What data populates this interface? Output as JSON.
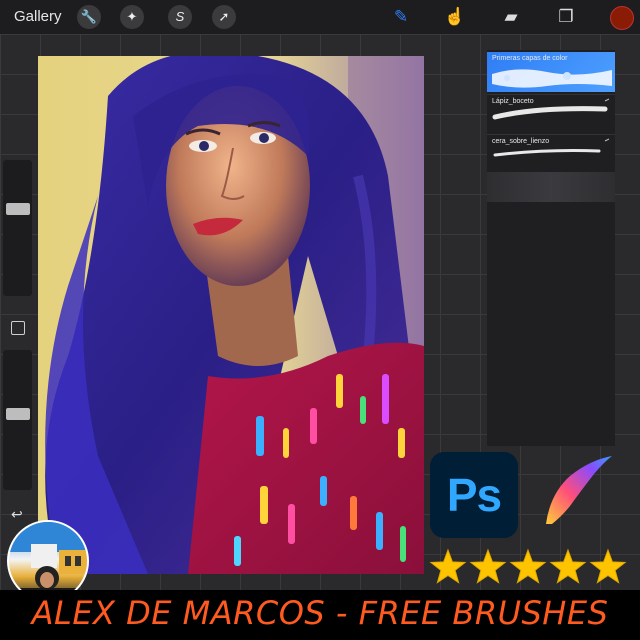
{
  "topbar": {
    "gallery_label": "Gallery",
    "actions": [
      {
        "name": "wrench-icon",
        "glyph": "🔧"
      },
      {
        "name": "magic-wand-icon",
        "glyph": "✦"
      },
      {
        "name": "selection-icon",
        "glyph": "S"
      },
      {
        "name": "transform-arrow-icon",
        "glyph": "➚"
      }
    ],
    "tools": [
      {
        "name": "brush-icon",
        "glyph": "✎"
      },
      {
        "name": "smudge-icon",
        "glyph": "☝"
      },
      {
        "name": "eraser-icon",
        "glyph": "▰"
      },
      {
        "name": "layers-icon",
        "glyph": "❐"
      }
    ],
    "current_color": "#8a1c06",
    "accent_color": "#2f7df5"
  },
  "brush_library": {
    "brushes": [
      {
        "name": "Primeras capas de color",
        "selected": true
      },
      {
        "name": "Lápiz_boceto",
        "selected": false
      },
      {
        "name": "cera_sobre_lienzo",
        "selected": false
      }
    ]
  },
  "sidebar": {
    "brush_size": 0.65,
    "brush_opacity": 0.55,
    "undo_icon": "↩"
  },
  "promo": {
    "ps_logo_text": "Ps",
    "rating_stars": 5,
    "banner_text": "ALEX DE MARCOS - FREE BRUSHES",
    "banner_color": "#ff5a1f"
  }
}
